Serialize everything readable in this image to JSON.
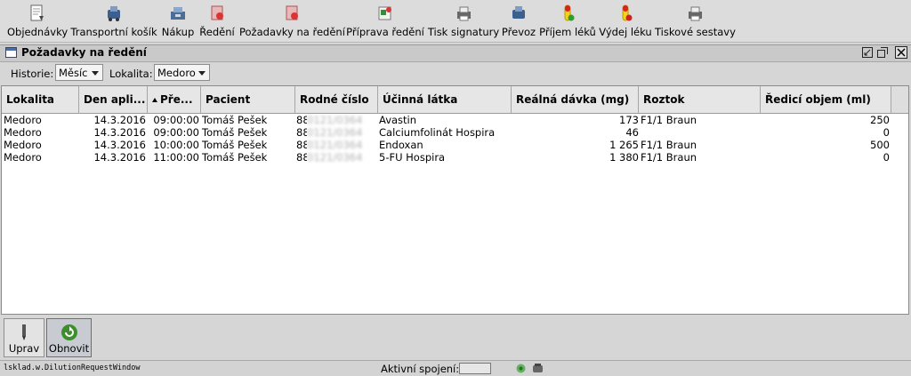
{
  "toolbar": {
    "items": [
      {
        "label": "Objednávky",
        "icon": "orders-icon"
      },
      {
        "label": "Transportní košík",
        "icon": "transport-cart-icon"
      },
      {
        "label": "Nákup",
        "icon": "purchase-icon"
      },
      {
        "label": "Ředění",
        "icon": "dilution-icon"
      },
      {
        "label": "Požadavky na ředění",
        "icon": "dilution-requests-icon"
      },
      {
        "label": "Příprava ředění",
        "icon": "dilution-preparation-icon"
      },
      {
        "label": "Tisk signatury",
        "icon": "print-signature-icon"
      },
      {
        "label": "Převoz",
        "icon": "transfer-icon"
      },
      {
        "label": "Příjem léků",
        "icon": "drug-receipt-icon"
      },
      {
        "label": "Výdej léku",
        "icon": "drug-dispense-icon"
      },
      {
        "label": "Tiskové sestavy",
        "icon": "print-reports-icon"
      }
    ]
  },
  "window": {
    "title": "Požadavky na ředění"
  },
  "filters": {
    "history_label": "Historie:",
    "history_value": "Měsíc",
    "location_label": "Lokalita:",
    "location_value": "Medoro"
  },
  "table": {
    "columns": [
      {
        "label": "Lokalita"
      },
      {
        "label": "Den apli..."
      },
      {
        "label": "Pře..."
      },
      {
        "label": "Pacient"
      },
      {
        "label": "Rodné číslo"
      },
      {
        "label": "Účinná látka"
      },
      {
        "label": "Reálná dávka (mg)"
      },
      {
        "label": "Roztok"
      },
      {
        "label": "Ředicí objem (ml)"
      }
    ],
    "rows": [
      {
        "lokalita": "Medoro",
        "den": "14.3.2016",
        "cas": "09:00:00",
        "pacient": "Tomáš Pešek",
        "rc_prefix": "88",
        "rc_hidden": "0121/0364",
        "latka": "Avastin",
        "davka": "173",
        "roztok": "F1/1 Braun",
        "objem": "250"
      },
      {
        "lokalita": "Medoro",
        "den": "14.3.2016",
        "cas": "09:00:00",
        "pacient": "Tomáš Pešek",
        "rc_prefix": "88",
        "rc_hidden": "0121/0364",
        "latka": "Calciumfolinát Hospira",
        "davka": "46",
        "roztok": "",
        "objem": "0"
      },
      {
        "lokalita": "Medoro",
        "den": "14.3.2016",
        "cas": "10:00:00",
        "pacient": "Tomáš Pešek",
        "rc_prefix": "88",
        "rc_hidden": "0121/0364",
        "latka": "Endoxan",
        "davka": "1 265",
        "roztok": "F1/1 Braun",
        "objem": "500"
      },
      {
        "lokalita": "Medoro",
        "den": "14.3.2016",
        "cas": "11:00:00",
        "pacient": "Tomáš Pešek",
        "rc_prefix": "88",
        "rc_hidden": "0121/0364",
        "latka": "5-FU Hospira",
        "davka": "1 380",
        "roztok": "F1/1 Braun",
        "objem": "0"
      }
    ]
  },
  "actions": {
    "edit_label": "Uprav",
    "refresh_label": "Obnovit"
  },
  "status": {
    "class_name": "lsklad.w.DilutionRequestWindow",
    "connection_label": "Aktivní spojení:"
  }
}
